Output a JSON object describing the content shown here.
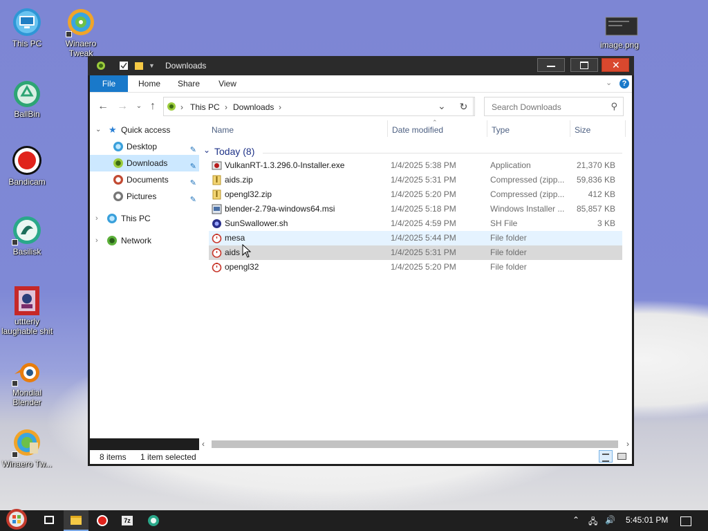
{
  "desktop": {
    "icons": [
      {
        "label": "This PC"
      },
      {
        "label": "Winaero Tweak"
      },
      {
        "label": "BallBin"
      },
      {
        "label": "Bandicam"
      },
      {
        "label": "Basilisk"
      },
      {
        "label": "uttterly laughable shit"
      },
      {
        "label": "Mondial Blender"
      },
      {
        "label": "Winaero Tw..."
      },
      {
        "label": "image.png"
      }
    ]
  },
  "window": {
    "title": "Downloads",
    "ribbon_tabs": [
      "File",
      "Home",
      "Share",
      "View"
    ],
    "breadcrumb": [
      "This PC",
      "Downloads"
    ],
    "search_placeholder": "Search Downloads",
    "nav_pane": {
      "quick_access": "Quick access",
      "items": [
        {
          "label": "Desktop",
          "pinned": true
        },
        {
          "label": "Downloads",
          "pinned": true,
          "selected": true
        },
        {
          "label": "Documents",
          "pinned": true
        },
        {
          "label": "Pictures",
          "pinned": true
        }
      ],
      "this_pc": "This PC",
      "network": "Network"
    },
    "columns": [
      "Name",
      "Date modified",
      "Type",
      "Size"
    ],
    "group_label": "Today (8)",
    "files": [
      {
        "name": "VulkanRT-1.3.296.0-Installer.exe",
        "date": "1/4/2025 5:38 PM",
        "type": "Application",
        "size": "21,370 KB",
        "icon": "exe-icon"
      },
      {
        "name": "aids.zip",
        "date": "1/4/2025 5:31 PM",
        "type": "Compressed (zipp...",
        "size": "59,836 KB",
        "icon": "zip-icon"
      },
      {
        "name": "opengl32.zip",
        "date": "1/4/2025 5:20 PM",
        "type": "Compressed (zipp...",
        "size": "412 KB",
        "icon": "zip-icon"
      },
      {
        "name": "blender-2.79a-windows64.msi",
        "date": "1/4/2025 5:18 PM",
        "type": "Windows Installer ...",
        "size": "85,857 KB",
        "icon": "msi-icon"
      },
      {
        "name": "SunSwallower.sh",
        "date": "1/4/2025 4:59 PM",
        "type": "SH File",
        "size": "3 KB",
        "icon": "sh-icon"
      },
      {
        "name": "mesa",
        "date": "1/4/2025 5:44 PM",
        "type": "File folder",
        "size": "",
        "icon": "folder-icon"
      },
      {
        "name": "aids",
        "date": "1/4/2025 5:31 PM",
        "type": "File folder",
        "size": "",
        "icon": "folder-icon"
      },
      {
        "name": "opengl32",
        "date": "1/4/2025 5:20 PM",
        "type": "File folder",
        "size": "",
        "icon": "folder-icon"
      }
    ],
    "status": {
      "item_count": "8 items",
      "selection": "1 item selected"
    }
  },
  "taskbar": {
    "clock": "5:45:01 PM"
  },
  "colors": {
    "accent": "#1979ca",
    "selected_nav": "#cce8ff",
    "hover_row": "#e5f3ff",
    "selected_row": "#d9d9d9",
    "titlebar": "#2b2b2b",
    "close_button": "#d9482e"
  }
}
